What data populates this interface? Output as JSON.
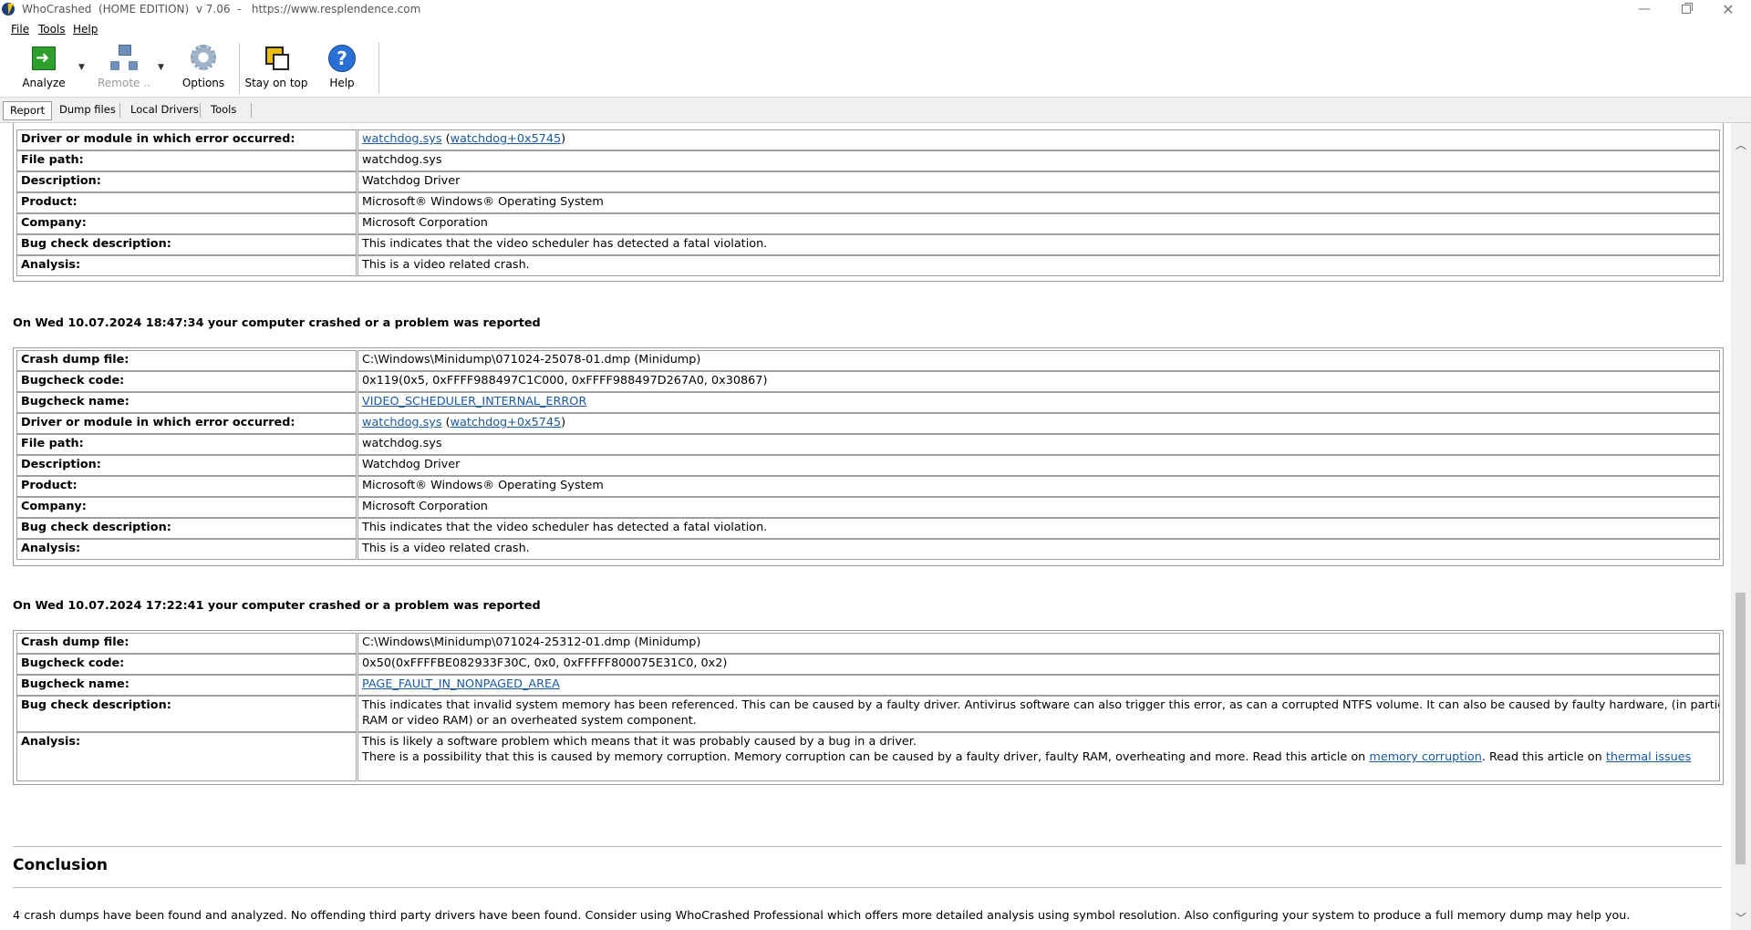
{
  "window": {
    "title": "WhoCrashed  (HOME EDITION)  v 7.06  -   https://www.resplendence.com"
  },
  "menu": {
    "file": "File",
    "tools": "Tools",
    "help": "Help"
  },
  "toolbar": {
    "analyze": "Analyze",
    "remote": "Remote ..",
    "options": "Options",
    "stay_on_top": "Stay on top",
    "help": "Help"
  },
  "tabs": {
    "report": "Report",
    "dump_files": "Dump files",
    "local_drivers": "Local Drivers",
    "tools": "Tools"
  },
  "labels": {
    "crash_dump_file": "Crash dump file:",
    "bugcheck_code": "Bugcheck code:",
    "bugcheck_name": "Bugcheck name:",
    "driver_module": "Driver or module in which error occurred:",
    "file_path": "File path:",
    "description": "Description:",
    "product": "Product:",
    "company": "Company:",
    "bug_check_description": "Bug check description:",
    "analysis": "Analysis:"
  },
  "crash_a": {
    "driver_link": "watchdog.sys",
    "driver_offset_link": "watchdog+0x5745",
    "file_path": "watchdog.sys",
    "description": "Watchdog Driver",
    "product": "Microsoft® Windows® Operating System",
    "company": "Microsoft Corporation",
    "bug_check_description": "This indicates that the video scheduler has detected a fatal violation.",
    "analysis": "This is a video related crash."
  },
  "crash_b": {
    "heading": "On Wed 10.07.2024 18:47:34 your computer crashed or a problem was reported",
    "crash_dump_file": "C:\\Windows\\Minidump\\071024-25078-01.dmp (Minidump)",
    "bugcheck_code": "0x119(0x5, 0xFFFF988497C1C000, 0xFFFF988497D267A0, 0x30867)",
    "bugcheck_name": "VIDEO_SCHEDULER_INTERNAL_ERROR",
    "driver_link": "watchdog.sys",
    "driver_offset_link": "watchdog+0x5745",
    "file_path": "watchdog.sys",
    "description": "Watchdog Driver",
    "product": "Microsoft® Windows® Operating System",
    "company": "Microsoft Corporation",
    "bug_check_description": "This indicates that the video scheduler has detected a fatal violation.",
    "analysis": "This is a video related crash."
  },
  "crash_c": {
    "heading": "On Wed 10.07.2024 17:22:41 your computer crashed or a problem was reported",
    "crash_dump_file": "C:\\Windows\\Minidump\\071024-25312-01.dmp (Minidump)",
    "bugcheck_code": "0x50(0xFFFFBE082933F30C, 0x0, 0xFFFFF800075E31C0, 0x2)",
    "bugcheck_name": "PAGE_FAULT_IN_NONPAGED_AREA",
    "bug_check_description_line1": "This indicates that invalid system memory has been referenced. This can be caused by a faulty driver. Antivirus software can also trigger this error, as can a corrupted NTFS volume. It can also be caused by faulty hardware, (in particular faulty or overheated",
    "bug_check_description_line2": "RAM or video RAM) or an overheated system component.",
    "analysis_line1": "This is likely a software problem which means that it was probably caused by a bug in a driver.",
    "analysis_line2_pre": "There is a possibility that this is caused by memory corruption. Memory corruption can be caused by a faulty driver, faulty RAM, overheating and more. Read this article on ",
    "analysis_link1": "memory corruption",
    "analysis_line2_mid": ". Read this article on ",
    "analysis_link2": "thermal issues"
  },
  "conclusion": {
    "title": "Conclusion",
    "text": "4 crash dumps have been found and analyzed. No offending third party drivers have been found. Consider using WhoCrashed Professional which offers more detailed analysis using symbol resolution. Also configuring your system to produce a full memory dump may help you."
  }
}
